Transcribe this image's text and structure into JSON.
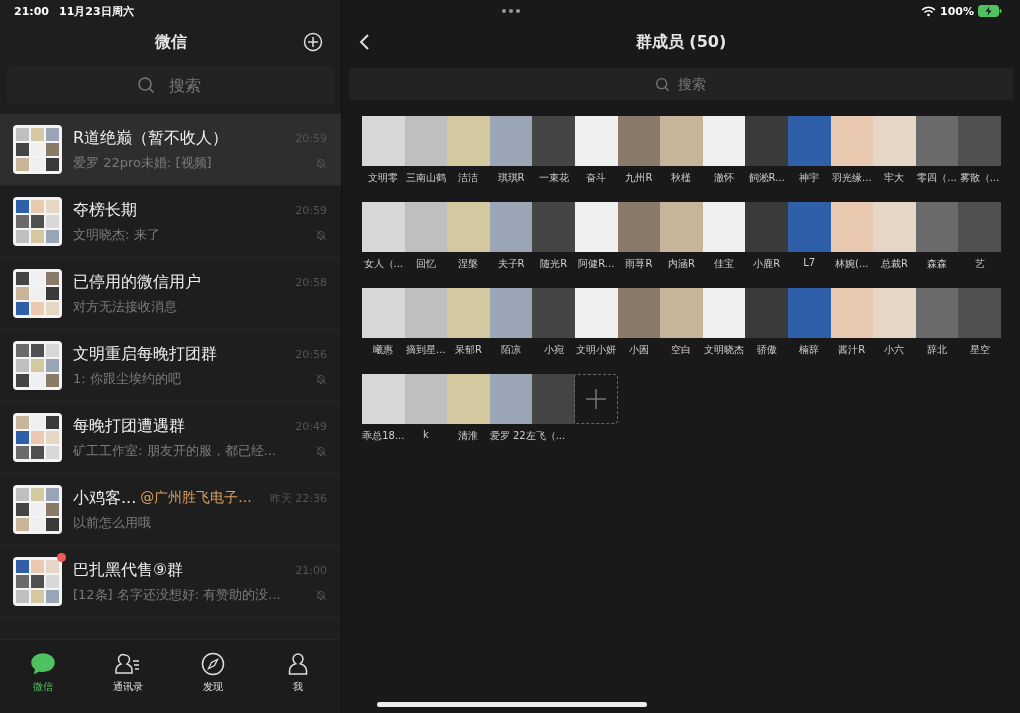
{
  "status_bar": {
    "time": "21:00",
    "date": "11月23日周六",
    "battery": "100%"
  },
  "sidebar": {
    "title": "微信",
    "search": {
      "placeholder": "搜索"
    },
    "chats": [
      {
        "name": "R道绝巅（暂不收人）",
        "preview": "爱罗 22pro未婚: [视频]",
        "time": "20:59",
        "muted": true,
        "selected": true,
        "unread": false
      },
      {
        "name": "夺榜长期",
        "preview": "文明晓杰: 来了",
        "time": "20:59",
        "muted": true,
        "selected": false,
        "unread": false
      },
      {
        "name": "已停用的微信用户",
        "preview": "对方无法接收消息",
        "time": "20:58",
        "muted": false,
        "selected": false,
        "unread": false
      },
      {
        "name": "文明重启每晚打团群",
        "preview": "1: 你跟尘埃约的吧",
        "time": "20:56",
        "muted": true,
        "selected": false,
        "unread": false
      },
      {
        "name": "每晚打团遭遇群",
        "preview": "矿工工作室: 朋友开的服，都已经...",
        "time": "20:49",
        "muted": true,
        "selected": false,
        "unread": false
      },
      {
        "name": "小鸡客...",
        "mention": "@广州胜飞电子...",
        "preview": "以前怎么用哦",
        "time": "昨天 22:36",
        "muted": false,
        "selected": false,
        "unread": false
      },
      {
        "name": "巴扎黑代售⑨群",
        "preview": "[12条] 名字还没想好: 有赞助的没...",
        "time": "21:00",
        "muted": true,
        "selected": false,
        "unread": true
      }
    ],
    "tabs": [
      {
        "label": "微信",
        "selected": true
      },
      {
        "label": "通讯录",
        "selected": false
      },
      {
        "label": "发现",
        "selected": false
      },
      {
        "label": "我",
        "selected": false
      }
    ]
  },
  "main": {
    "title": "群成员 (50)",
    "search": {
      "placeholder": "搜索"
    },
    "members": [
      {
        "kind": "named",
        "name": "文明零"
      },
      {
        "kind": "named",
        "name": "三南山鹤"
      },
      {
        "kind": "named",
        "name": "洁洁"
      },
      {
        "kind": "named",
        "name": "琪琪R"
      },
      {
        "kind": "named",
        "name": "一束花"
      },
      {
        "kind": "named",
        "name": "奋斗"
      },
      {
        "kind": "named",
        "name": "九州R"
      },
      {
        "kind": "named",
        "name": "秋槿"
      },
      {
        "kind": "named",
        "name": "澈怀"
      },
      {
        "kind": "named",
        "name": "飼淞R..."
      },
      {
        "kind": "named",
        "name": "神宇"
      },
      {
        "kind": "named",
        "name": "羽光缘..."
      },
      {
        "kind": "named",
        "name": "牢大"
      },
      {
        "kind": "named",
        "name": "零四（..."
      },
      {
        "kind": "named",
        "name": "雾散（..."
      },
      {
        "kind": "named",
        "name": "女人（..."
      },
      {
        "kind": "named",
        "name": "回忆"
      },
      {
        "kind": "named",
        "name": "涅槃"
      },
      {
        "kind": "named",
        "name": "夫子R"
      },
      {
        "kind": "named",
        "name": "随光R"
      },
      {
        "kind": "named",
        "name": "阿健R..."
      },
      {
        "kind": "named",
        "name": "雨荨R"
      },
      {
        "kind": "named",
        "name": "内涵R"
      },
      {
        "kind": "named",
        "name": "佳宝"
      },
      {
        "kind": "named",
        "name": "小鹿R"
      },
      {
        "kind": "named",
        "name": "L7"
      },
      {
        "kind": "named",
        "name": "林婉(..."
      },
      {
        "kind": "named",
        "name": "总裁R"
      },
      {
        "kind": "named",
        "name": "森森"
      },
      {
        "kind": "named",
        "name": "艺"
      },
      {
        "kind": "named",
        "name": "曦惠"
      },
      {
        "kind": "named",
        "name": "摘到星..."
      },
      {
        "kind": "named",
        "name": "呆郁R"
      },
      {
        "kind": "named",
        "name": "陌凉"
      },
      {
        "kind": "named",
        "name": "小宛"
      },
      {
        "kind": "named",
        "name": "文明小妍"
      },
      {
        "kind": "named",
        "name": "小囷"
      },
      {
        "kind": "named",
        "name": "空白"
      },
      {
        "kind": "named",
        "name": "文明晓杰"
      },
      {
        "kind": "named",
        "name": "骄傲"
      },
      {
        "kind": "named",
        "name": "楠辞"
      },
      {
        "kind": "named",
        "name": "酱汁R"
      },
      {
        "kind": "named",
        "name": "小六"
      },
      {
        "kind": "named",
        "name": "辞北"
      },
      {
        "kind": "named",
        "name": "星空"
      },
      {
        "kind": "named",
        "name": "乖总18..."
      },
      {
        "kind": "named",
        "name": "k"
      },
      {
        "kind": "named",
        "name": "清淮"
      },
      {
        "kind": "named",
        "name": "爱罗 22左飞（..."
      },
      {
        "kind": "unnamed"
      }
    ]
  }
}
